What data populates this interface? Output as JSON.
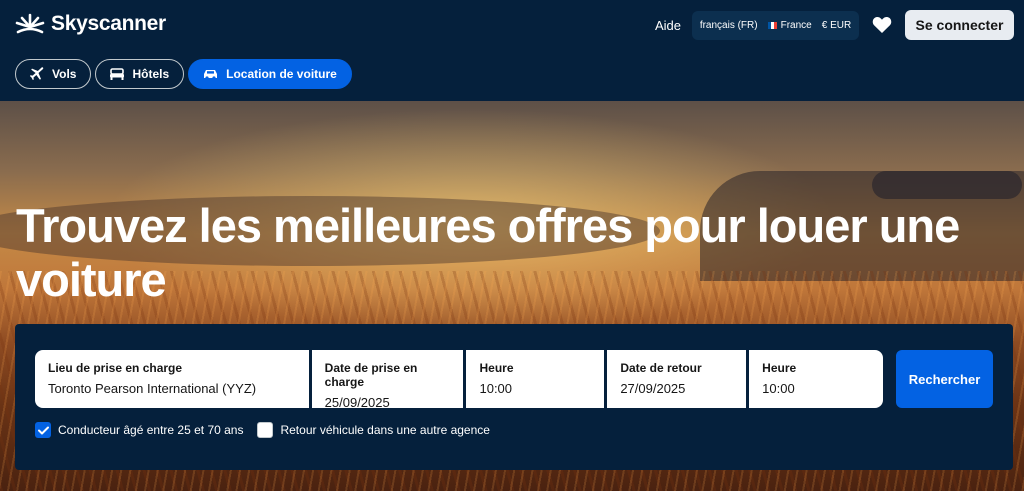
{
  "brand": {
    "name": "Skyscanner"
  },
  "header": {
    "help": "Aide",
    "locale": {
      "language": "français (FR)",
      "country": "France",
      "currency": "€ EUR"
    },
    "login": "Se connecter"
  },
  "tabs": [
    {
      "label": "Vols",
      "icon": "plane-icon",
      "active": false
    },
    {
      "label": "Hôtels",
      "icon": "bed-icon",
      "active": false
    },
    {
      "label": "Location de voiture",
      "icon": "car-icon",
      "active": true
    }
  ],
  "hero": {
    "headline": "Trouvez les meilleures offres pour louer une voiture"
  },
  "search": {
    "pickup_location": {
      "label": "Lieu de prise en charge",
      "value": "Toronto Pearson International (YYZ)"
    },
    "pickup_date": {
      "label": "Date de prise en charge",
      "value": "25/09/2025"
    },
    "pickup_time": {
      "label": "Heure",
      "value": "10:00"
    },
    "return_date": {
      "label": "Date de retour",
      "value": "27/09/2025"
    },
    "return_time": {
      "label": "Heure",
      "value": "10:00"
    },
    "button": "Rechercher"
  },
  "options": {
    "driver_age": {
      "label": "Conducteur âgé entre 25 et 70 ans",
      "checked": true
    },
    "different_return": {
      "label": "Retour véhicule dans une autre agence",
      "checked": false
    }
  },
  "colors": {
    "navy": "#05203c",
    "accent_blue": "#0362e3"
  }
}
